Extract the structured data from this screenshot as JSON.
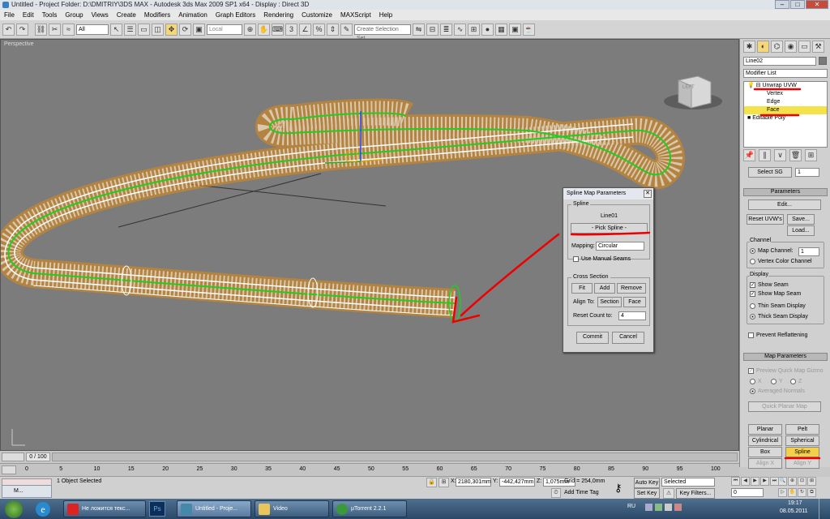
{
  "titlebar": {
    "text": "Untitled    - Project Folder: D:\\DMITRIY\\3DS MAX    - Autodesk 3ds Max  2009 SP1  x64       - Display : Direct 3D",
    "min": "–",
    "max": "□",
    "close": "✕"
  },
  "menu": [
    "File",
    "Edit",
    "Tools",
    "Group",
    "Views",
    "Create",
    "Modifiers",
    "Animation",
    "Graph Editors",
    "Rendering",
    "Customize",
    "MAXScript",
    "Help"
  ],
  "toolbar": {
    "filter": "All",
    "coord": "Local",
    "selection_set": "Create Selection Set"
  },
  "viewport": {
    "label": "Perspective",
    "viewcube_label": "LEFT"
  },
  "command_panel": {
    "object_name": "Line02",
    "modifier_list": "Modifier List",
    "stack": [
      {
        "label": "Unwrap UVW",
        "level": 0
      },
      {
        "label": "Vertex",
        "level": 1
      },
      {
        "label": "Edge",
        "level": 1
      },
      {
        "label": "Face",
        "level": 1,
        "selected": true
      },
      {
        "label": "Editable Poly",
        "level": 0
      }
    ],
    "select_sg": "Select SG",
    "select_sg_value": "1",
    "parameters": {
      "title": "Parameters",
      "edit": "Edit...",
      "reset": "Reset UVW's",
      "save": "Save...",
      "load": "Load...",
      "channel_title": "Channel",
      "map_channel": "Map Channel:",
      "map_channel_value": "1",
      "vertex_color": "Vertex Color Channel",
      "display_title": "Display",
      "show_seam": "Show Seam",
      "show_map_seam": "Show Map Seam",
      "thin_seam": "Thin Seam Display",
      "thick_seam": "Thick Seam Display",
      "prevent": "Prevent Reflattening"
    },
    "map_parameters": {
      "title": "Map Parameters",
      "preview": "Preview Quick Map Gizmo",
      "x": "X",
      "y": "Y",
      "z": "Z",
      "averaged": "Averaged Normals",
      "quick_planar": "Quick Planar Map",
      "planar": "Planar",
      "pelt": "Pelt",
      "cylindrical": "Cylindrical",
      "spherical": "Spherical",
      "box": "Box",
      "spline": "Spline",
      "align_x": "Align X",
      "align_y": "Align Y"
    }
  },
  "dialog": {
    "title": "Spline Map Parameters",
    "close": "✕",
    "spline_group": "Spline",
    "spline_name": "Line01",
    "pick_spline": "- Pick Spline -",
    "mapping_label": "Mapping:",
    "mapping_value": "Circular",
    "use_manual_seams": "Use Manual Seams",
    "cross_section": "Cross Section",
    "fit": "Fit",
    "add": "Add",
    "remove": "Remove",
    "align_to": "Align To:",
    "section": "Section",
    "face": "Face",
    "reset_count": "Reset Count to:",
    "reset_count_value": "4",
    "commit": "Commit",
    "cancel": "Cancel"
  },
  "timeline": {
    "frame": "0 / 100",
    "ticks": [
      "0",
      "5",
      "10",
      "15",
      "20",
      "25",
      "30",
      "35",
      "40",
      "45",
      "50",
      "55",
      "60",
      "65",
      "70",
      "75",
      "80",
      "85",
      "90",
      "95",
      "100"
    ]
  },
  "status": {
    "selected": "1 Object Selected",
    "x_label": "X:",
    "x": "2180,301mm",
    "y_label": "Y:",
    "y": "-442,427mm",
    "z_label": "Z:",
    "z": "1,075mm",
    "grid": "Grid = 254,0mm",
    "add_time_tag": "Add Time Tag",
    "auto_key": "Auto Key",
    "selected_filter": "Selected",
    "set_key": "Set Key",
    "key_filters": "Key Filters...",
    "frame_field": "0",
    "listener": "M..."
  },
  "taskbar": {
    "items": [
      {
        "label": "Не ложится текс..."
      },
      {
        "label": "Untitled    - Proje..."
      },
      {
        "label": "Video"
      },
      {
        "label": "µTorrent 2.2.1"
      }
    ],
    "lang": "RU",
    "time": "19:17",
    "date": "08.05.2011"
  },
  "colors": {
    "accent_yellow": "#f4d04a",
    "viewport_bg": "#7c7c7c",
    "annotation_red": "#e00000",
    "spline_green": "#22cc22",
    "tube_orange": "#e08a10"
  }
}
